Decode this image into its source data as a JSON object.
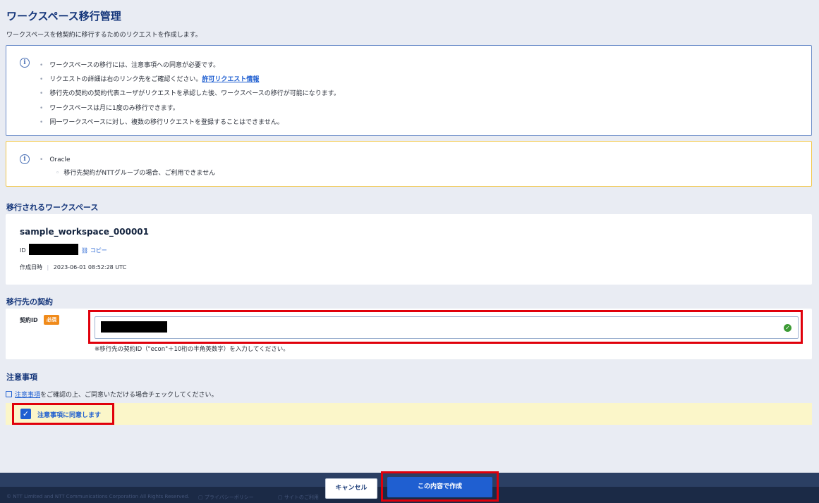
{
  "page": {
    "title": "ワークスペース移行管理",
    "description": "ワークスペースを他契約に移行するためのリクエストを作成します。"
  },
  "info_notice": {
    "items": [
      "ワークスペースの移行には、注意事項への同意が必要です。",
      "リクエストの詳細は右のリンク先をご確認ください。",
      "移行先の契約の契約代表ユーザがリクエストを承認した後、ワークスペースの移行が可能になります。",
      "ワークスペースは月に1度のみ移行できます。",
      "同一ワークスペースに対し、複数の移行リクエストを登録することはできません。"
    ],
    "link_label": "許可リクエスト情報"
  },
  "warning_notice": {
    "service": "Oracle",
    "detail": "移行先契約がNTTグループの場合、ご利用できません"
  },
  "workspace_section": {
    "title": "移行されるワークスペース",
    "name": "sample_workspace_000001",
    "id_label": "ID",
    "copy_label": "コピー",
    "created_label": "作成日時",
    "created_value": "2023-06-01 08:52:28 UTC"
  },
  "contract_section": {
    "title": "移行先の契約",
    "field_label": "契約ID",
    "required_badge": "必須",
    "hint": "※移行先の契約ID（\"econ\"＋10桁の半角英数字）を入力してください。"
  },
  "notes_section": {
    "title": "注意事項",
    "link_label": "注意事項",
    "description_rest": "をご確認の上、ご同意いただける場合チェックしてください。",
    "agree_label": "注意事項に同意します",
    "agree_checked": true
  },
  "footer": {
    "copyright": "© NTT Limited and NTT Communications Corporation All Rights Reserved.",
    "privacy": "プライバシーポリシー",
    "terms": "サイトのご利用"
  },
  "actions": {
    "cancel_label": "キャンセル",
    "create_label": "この内容で作成"
  },
  "colors": {
    "accent": "#1f5fd1",
    "title": "#14357a",
    "highlight_frame": "#e0000b",
    "warning_border": "#f2c84b",
    "required_badge": "#f08a1a"
  }
}
